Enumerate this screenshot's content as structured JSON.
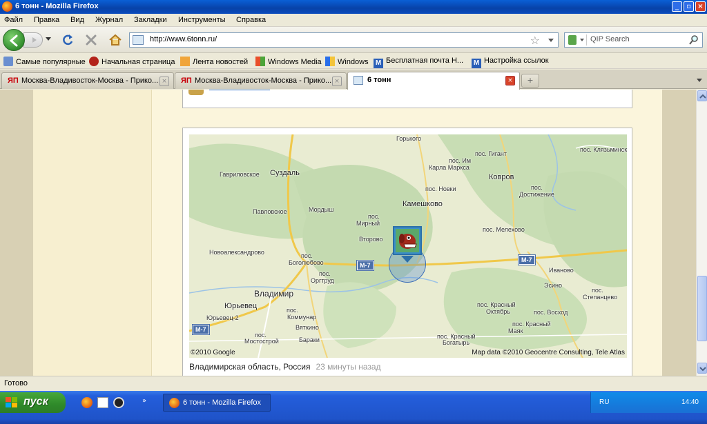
{
  "window": {
    "title": "6 тонн - Mozilla Firefox"
  },
  "menu": [
    "Файл",
    "Правка",
    "Вид",
    "Журнал",
    "Закладки",
    "Инструменты",
    "Справка"
  ],
  "address": {
    "url": "http://www.6tonn.ru/"
  },
  "search": {
    "placeholder": "QIP Search"
  },
  "bookmarks": [
    {
      "label": "Самые популярные",
      "icon": "popular-icon"
    },
    {
      "label": "Начальная страница",
      "icon": "home-page-icon"
    },
    {
      "label": "Лента новостей",
      "icon": "rss-icon"
    },
    {
      "label": "Windows Media",
      "icon": "windows-icon"
    },
    {
      "label": "Windows",
      "icon": "windows-icon"
    },
    {
      "label": "Бесплатная почта Н...",
      "icon": "mail-icon"
    },
    {
      "label": "Настройка ссылок",
      "icon": "mail-icon"
    }
  ],
  "tabs": [
    {
      "label": "Москва-Владивосток-Москва - Прико...",
      "icon": "ЯП",
      "active": false
    },
    {
      "label": "Москва-Владивосток-Москва - Прико...",
      "icon": "ЯП",
      "active": false
    },
    {
      "label": "6 тонн",
      "icon": "site-icon",
      "active": true
    }
  ],
  "map": {
    "labels": {
      "gorkogo": "Горького",
      "gigant": "пос. Гигант",
      "klyazm": "пос. Клязьминский-Городок",
      "gavrilovskoe": "Гавриловское",
      "suzdal": "Суздаль",
      "im_karla": "пос. Им",
      "karla_marksa": "Карла Маркса",
      "kovrov": "Ковров",
      "novki": "пос. Новки",
      "pos_dost": "пос.",
      "dostizhenie": "Достижение",
      "pavlovskoe": "Павловское",
      "mordysh": "Мордыш",
      "kameshkovo": "Камешково",
      "pos_mirny": "пос.",
      "mirny": "Мирный",
      "melekhovo": "пос. Мелехово",
      "vtorovo": "Второво",
      "novoaleks": "Новоалександрово",
      "pos_bog": "пос.",
      "bogolyubovo": "Боголюбово",
      "ivanovo": "Иваново",
      "pos_orgtrud": "пос.",
      "orgtrud": "Оргтруд",
      "esino": "Эсино",
      "vladimir": "Владимир",
      "pos_step": "пос.",
      "stepantsevo": "Степанцево",
      "yurevets": "Юрьевец",
      "pos_komm": "пос.",
      "kommunar": "Коммунар",
      "krasny_okt": "пос. Красный",
      "oktyabr": "Октябрь",
      "voskhod": "пос. Восход",
      "yurevets2": "Юрьевец-2",
      "vyatkino": "Вяткино",
      "krasny_mayak": "пос. Красный",
      "mayak": "Маяк",
      "pos_most": "пос.",
      "mostostroy": "Мостострой",
      "baraki": "Бараки",
      "krasny_bog": "пос. Красный",
      "bogatyr": "Богатырь"
    },
    "shields": {
      "m7_a": "М-7",
      "m7_b": "М-7",
      "m7_c": "М-7"
    },
    "copyright": "©2010 Google",
    "attribution": "Map data ©2010 Geocentre Consulting, Tele Atlas",
    "location": "Владимирская область, Россия",
    "time_ago": "23 минуты назад"
  },
  "status": "Готово",
  "taskbar": {
    "start": "пуск",
    "task": "6 тонн - Mozilla Firefox",
    "lang": "RU",
    "time": "14:40"
  }
}
